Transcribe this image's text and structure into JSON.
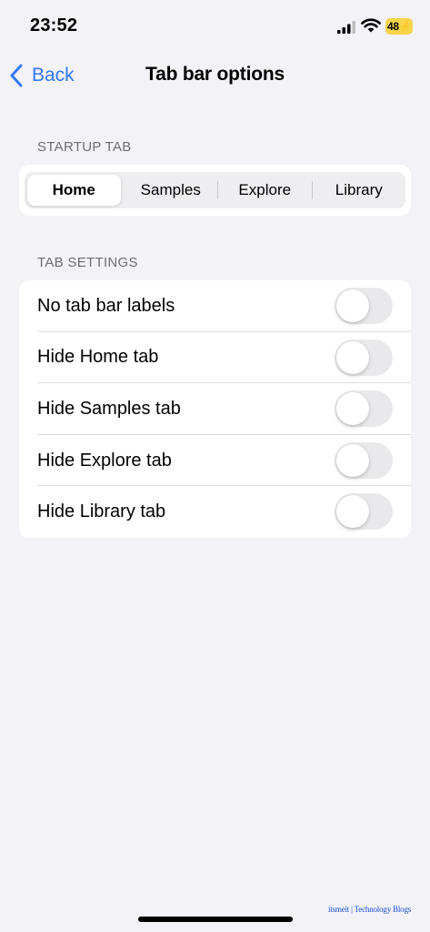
{
  "status_bar": {
    "time": "23:52",
    "battery": "48",
    "signal_icon": "cellular-signal-icon",
    "wifi_icon": "wifi-icon",
    "battery_icon": "battery-charging-icon"
  },
  "nav": {
    "back_label": "Back",
    "back_icon": "chevron-left-icon",
    "title": "Tab bar options"
  },
  "startup_section": {
    "header": "STARTUP TAB",
    "segments": [
      "Home",
      "Samples",
      "Explore",
      "Library"
    ],
    "selected": "Home"
  },
  "settings_section": {
    "header": "TAB SETTINGS",
    "rows": [
      {
        "label": "No tab bar labels",
        "on": false
      },
      {
        "label": "Hide Home tab",
        "on": false
      },
      {
        "label": "Hide Samples tab",
        "on": false
      },
      {
        "label": "Hide Explore tab",
        "on": false
      },
      {
        "label": "Hide Library tab",
        "on": false
      }
    ]
  },
  "watermark": "itsmeit | Technology Blogs",
  "colors": {
    "accent": "#3478f6",
    "background": "#f2f2f7",
    "battery": "#f7d44a",
    "toggle_off": "#e9e9eb"
  }
}
